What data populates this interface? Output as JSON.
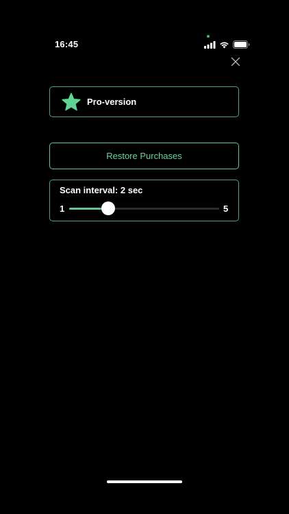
{
  "status_bar": {
    "time": "16:45",
    "icons": [
      "signal-icon",
      "wifi-icon",
      "battery-icon"
    ],
    "privacy_indicator_color": "#34c759"
  },
  "close_button": {
    "icon": "close-icon"
  },
  "pro_card": {
    "icon": "star-icon",
    "icon_color": "#5fd496",
    "label": "Pro-version"
  },
  "restore_button": {
    "label": "Restore Purchases"
  },
  "scan_interval": {
    "title": "Scan interval: 2 sec",
    "min_label": "1",
    "max_label": "5",
    "min": 1,
    "max": 5,
    "value": 2
  },
  "colors": {
    "background": "#000000",
    "accent": "#5fc991",
    "card_border": "#4ea37c"
  }
}
